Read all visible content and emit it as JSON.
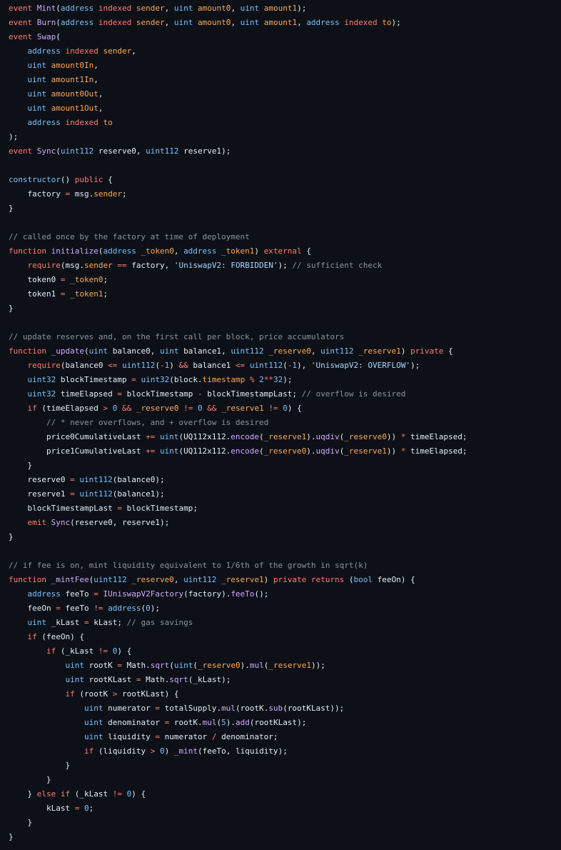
{
  "colors": {
    "keyword": "#ff7b72",
    "function": "#d2a8ff",
    "type": "#79c0ff",
    "variable": "#ffa657",
    "string": "#a5d6ff",
    "comment": "#8b949e",
    "number": "#79c0ff",
    "plain": "#e6edf3"
  },
  "code_lines": [
    "event Mint(address indexed sender, uint amount0, uint amount1);",
    "event Burn(address indexed sender, uint amount0, uint amount1, address indexed to);",
    "event Swap(",
    "    address indexed sender,",
    "    uint amount0In,",
    "    uint amount1In,",
    "    uint amount0Out,",
    "    uint amount1Out,",
    "    address indexed to",
    ");",
    "event Sync(uint112 reserve0, uint112 reserve1);",
    "",
    "constructor() public {",
    "    factory = msg.sender;",
    "}",
    "",
    "// called once by the factory at time of deployment",
    "function initialize(address _token0, address _token1) external {",
    "    require(msg.sender == factory, 'UniswapV2: FORBIDDEN'); // sufficient check",
    "    token0 = _token0;",
    "    token1 = _token1;",
    "}",
    "",
    "// update reserves and, on the first call per block, price accumulators",
    "function _update(uint balance0, uint balance1, uint112 _reserve0, uint112 _reserve1) private {",
    "    require(balance0 <= uint112(-1) && balance1 <= uint112(-1), 'UniswapV2: OVERFLOW');",
    "    uint32 blockTimestamp = uint32(block.timestamp % 2**32);",
    "    uint32 timeElapsed = blockTimestamp - blockTimestampLast; // overflow is desired",
    "    if (timeElapsed > 0 && _reserve0 != 0 && _reserve1 != 0) {",
    "        // * never overflows, and + overflow is desired",
    "        price0CumulativeLast += uint(UQ112x112.encode(_reserve1).uqdiv(_reserve0)) * timeElapsed;",
    "        price1CumulativeLast += uint(UQ112x112.encode(_reserve0).uqdiv(_reserve1)) * timeElapsed;",
    "    }",
    "    reserve0 = uint112(balance0);",
    "    reserve1 = uint112(balance1);",
    "    blockTimestampLast = blockTimestamp;",
    "    emit Sync(reserve0, reserve1);",
    "}",
    "",
    "// if fee is on, mint liquidity equivalent to 1/6th of the growth in sqrt(k)",
    "function _mintFee(uint112 _reserve0, uint112 _reserve1) private returns (bool feeOn) {",
    "    address feeTo = IUniswapV2Factory(factory).feeTo();",
    "    feeOn = feeTo != address(0);",
    "    uint _kLast = kLast; // gas savings",
    "    if (feeOn) {",
    "        if (_kLast != 0) {",
    "            uint rootK = Math.sqrt(uint(_reserve0).mul(_reserve1));",
    "            uint rootKLast = Math.sqrt(_kLast);",
    "            if (rootK > rootKLast) {",
    "                uint numerator = totalSupply.mul(rootK.sub(rootKLast));",
    "                uint denominator = rootK.mul(5).add(rootKLast);",
    "                uint liquidity = numerator / denominator;",
    "                if (liquidity > 0) _mint(feeTo, liquidity);",
    "            }",
    "        }",
    "    } else if (_kLast != 0) {",
    "        kLast = 0;",
    "    }",
    "}"
  ]
}
